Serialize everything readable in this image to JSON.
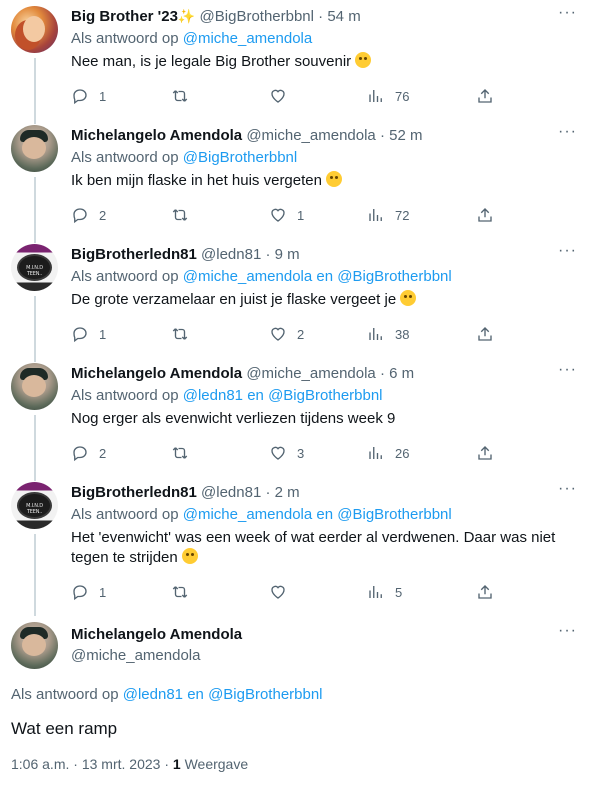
{
  "tweets": [
    {
      "avatar": "bigbrother23-avatar",
      "name": "Big Brother '23",
      "name_suffix": "✨",
      "handle": "@BigBrotherbbnl",
      "sep": "·",
      "time": "54 m",
      "reply_prefix": "Als antwoord op",
      "reply_to": "@miche_amendola",
      "reply_join": "",
      "reply_to2": "",
      "text": "Nee man, is je legale Big Brother souvenir",
      "emoji": "zany-face",
      "replies": "1",
      "retweets": "",
      "likes": "",
      "views": "76"
    },
    {
      "avatar": "miche-avatar",
      "name": "Michelangelo Amendola",
      "name_suffix": "",
      "handle": "@miche_amendola",
      "sep": "·",
      "time": "52 m",
      "reply_prefix": "Als antwoord op",
      "reply_to": "@BigBrotherbbnl",
      "reply_join": "",
      "reply_to2": "",
      "text": "Ik ben mijn flaske in het huis vergeten",
      "emoji": "relieved-face",
      "replies": "2",
      "retweets": "",
      "likes": "1",
      "views": "72"
    },
    {
      "avatar": "ledn81-avatar",
      "name": "BigBrotherledn81",
      "name_suffix": "",
      "handle": "@ledn81",
      "sep": "·",
      "time": "9 m",
      "reply_prefix": "Als antwoord op",
      "reply_to": "@miche_amendola",
      "reply_join": "en",
      "reply_to2": "@BigBrotherbbnl",
      "text": "De grote verzamelaar en juist je flaske vergeet je",
      "emoji": "rofl-face",
      "replies": "1",
      "retweets": "",
      "likes": "2",
      "views": "38"
    },
    {
      "avatar": "miche-avatar",
      "name": "Michelangelo Amendola",
      "name_suffix": "",
      "handle": "@miche_amendola",
      "sep": "·",
      "time": "6 m",
      "reply_prefix": "Als antwoord op",
      "reply_to": "@ledn81",
      "reply_join": "en",
      "reply_to2": "@BigBrotherbbnl",
      "text": "Nog erger als evenwicht verliezen tijdens week 9",
      "emoji": "",
      "replies": "2",
      "retweets": "",
      "likes": "3",
      "views": "26"
    },
    {
      "avatar": "ledn81-avatar",
      "name": "BigBrotherledn81",
      "name_suffix": "",
      "handle": "@ledn81",
      "sep": "·",
      "time": "2 m",
      "reply_prefix": "Als antwoord op",
      "reply_to": "@miche_amendola",
      "reply_join": "en",
      "reply_to2": "@BigBrotherbbnl",
      "text": "Het 'evenwicht' was een week of wat eerder al verdwenen. Daar was niet tegen te strijden",
      "emoji": "rolling-eyes-face",
      "replies": "1",
      "retweets": "",
      "likes": "",
      "views": "5"
    }
  ],
  "ledn_avatar_text": "M.I.N.D TEEN..",
  "main_tweet": {
    "name": "Michelangelo Amendola",
    "handle": "@miche_amendola",
    "reply_prefix": "Als antwoord op",
    "reply_to": "@ledn81",
    "reply_join": "en",
    "reply_to2": "@BigBrotherbbnl",
    "text": "Wat een ramp",
    "time": "1:06 a.m.",
    "date": "13 mrt. 2023",
    "views_count": "1",
    "views_label": "Weergave"
  },
  "colors": {
    "link": "#1d9bf0",
    "muted": "#536471",
    "text": "#0f1419",
    "thread_line": "#cfd9de"
  }
}
